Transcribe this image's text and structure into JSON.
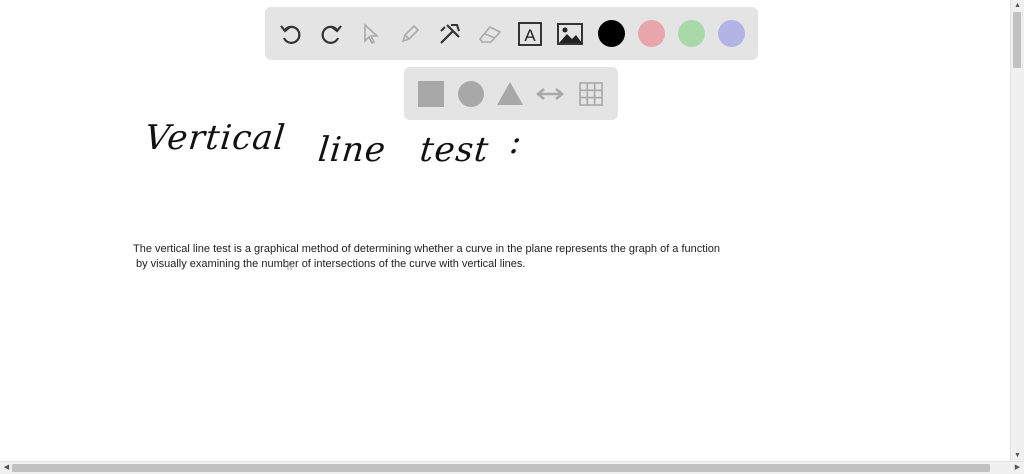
{
  "toolbar": {
    "tools": [
      {
        "icon": "undo-icon"
      },
      {
        "icon": "redo-icon"
      },
      {
        "icon": "select-pointer-icon"
      },
      {
        "icon": "pen-icon"
      },
      {
        "icon": "tools-icon"
      },
      {
        "icon": "eraser-icon"
      },
      {
        "icon": "text-box-icon",
        "glyph": "A"
      },
      {
        "icon": "image-icon"
      }
    ],
    "colors": [
      "#000000",
      "#e8a5ac",
      "#a9d8a9",
      "#b3b3e6"
    ]
  },
  "shapebar": {
    "shapes": [
      "square-icon",
      "circle-icon",
      "triangle-icon",
      "double-arrow-icon",
      "grid-icon"
    ],
    "color": "#a8a8a8"
  },
  "canvas": {
    "heading_words": [
      "Vertical",
      "line",
      "test",
      ":"
    ],
    "paragraph_lines": [
      "The vertical line test is a graphical method of determining whether a curve in the plane represents the graph of a function",
      "by visually examining the number of intersections of the curve with vertical lines."
    ]
  },
  "scrollbars": {
    "up": "▲",
    "down": "▼",
    "left": "◀",
    "right": "▶"
  }
}
